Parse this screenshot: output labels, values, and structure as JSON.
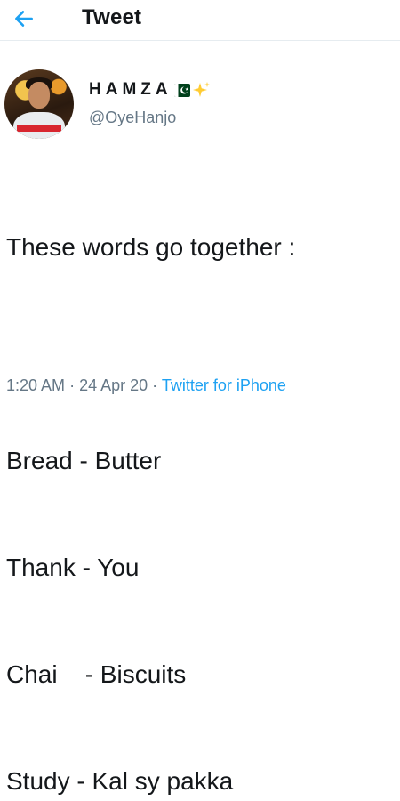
{
  "header": {
    "back_icon": "arrow-left-icon",
    "title": "Tweet"
  },
  "tweet": {
    "author": {
      "display_name": "HAMZA",
      "handle": "@OyeHanjo",
      "badges": [
        "pakistan-flag-icon",
        "sparkles-icon"
      ]
    },
    "lines": [
      "These words go together :",
      "",
      "Bread - Butter",
      "Thank - You",
      "Chai    - Biscuits",
      "Study - Kal sy pakka"
    ],
    "time": "1:20 AM",
    "separator": "·",
    "date": "24 Apr 20",
    "source": "Twitter for iPhone"
  },
  "colors": {
    "accent": "#1da1f2",
    "text": "#14171a",
    "secondary": "#657786",
    "divider": "#e6ecf0"
  }
}
